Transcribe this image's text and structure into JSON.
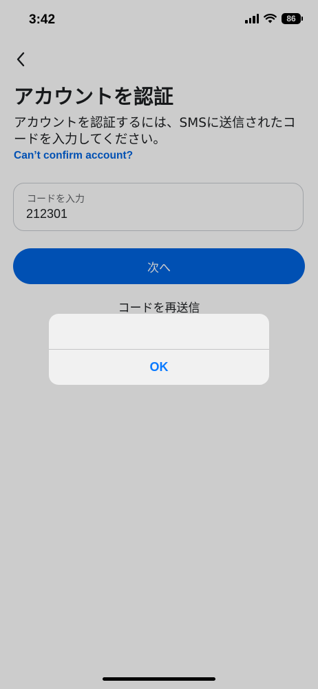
{
  "status_bar": {
    "time": "3:42",
    "battery": "86",
    "icons": [
      "signal-icon",
      "wifi-icon",
      "battery-icon"
    ]
  },
  "nav": {
    "back_icon": "chevron-left-icon"
  },
  "title": "アカウントを認証",
  "description": "アカウントを認証するには、SMSに送信されたコードを入力してください。",
  "help_link": "Can’t confirm account?",
  "code_field": {
    "label": "コードを入力",
    "value": "212301"
  },
  "next_button": "次へ",
  "resend_button": "コードを再送信",
  "alert": {
    "ok_label": "OK"
  },
  "colors": {
    "primary": "#0064e0",
    "link": "#0064e0",
    "alert_action": "#0a7aff"
  }
}
